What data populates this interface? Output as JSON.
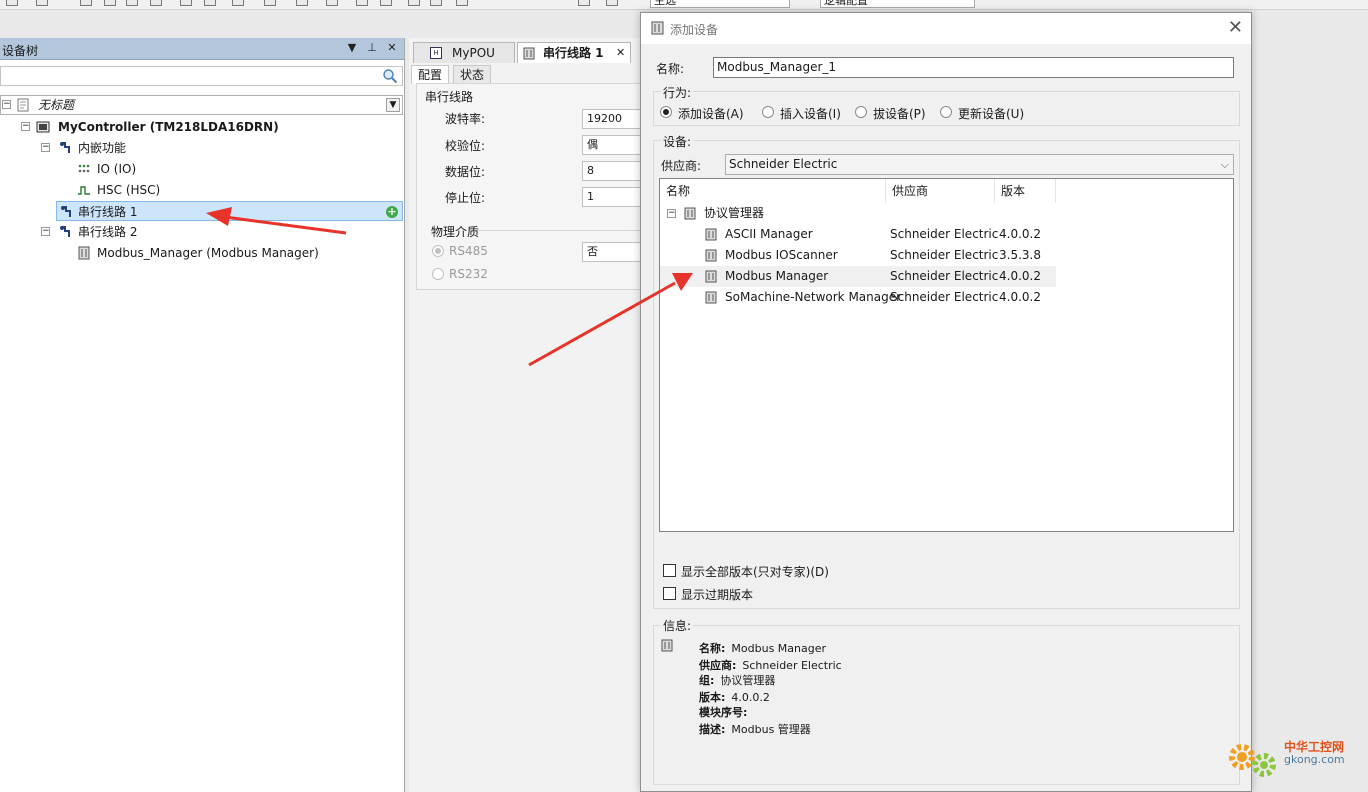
{
  "toolbar": {
    "combo1": "主选",
    "combo2": "逻辑配置"
  },
  "device_tree": {
    "title": "设备树",
    "pin_glyph": "▼  ᵖ",
    "close_glyph": "✕",
    "nodes": {
      "root": "无标题",
      "controller": "MyController (TM218LDA16DRN)",
      "embedded": "内嵌功能",
      "io": "IO (IO)",
      "hsc": "HSC (HSC)",
      "serial1": "串行线路 1",
      "serial2": "串行线路 2",
      "modbus": "Modbus_Manager (Modbus Manager)"
    }
  },
  "editor": {
    "tabs": {
      "mypou": "MyPOU",
      "serial": "串行线路 1"
    },
    "tab_close": "✕",
    "config_tabs": {
      "config": "配置",
      "status": "状态"
    },
    "group_serial": "串行线路",
    "fields": {
      "baud_label": "波特率:",
      "baud_value": "19200",
      "parity_label": "校验位:",
      "parity_value": "偶",
      "databits_label": "数据位:",
      "databits_value": "8",
      "stopbits_label": "停止位:",
      "stopbits_value": "1"
    },
    "group_medium": "物理介质",
    "medium": {
      "rs485": "RS485",
      "rs232": "RS232",
      "value": "否"
    }
  },
  "dialog": {
    "title": "添加设备",
    "close_glyph": "✕",
    "name_label": "名称:",
    "name_value": "Modbus_Manager_1",
    "action_label": "行为:",
    "actions": [
      {
        "label": "添加设备(A)",
        "selected": true
      },
      {
        "label": "插入设备(I)",
        "selected": false
      },
      {
        "label": "拔设备(P)",
        "selected": false
      },
      {
        "label": "更新设备(U)",
        "selected": false
      }
    ],
    "device_label": "设备:",
    "vendor_label": "供应商:",
    "vendor_value": "Schneider Electric",
    "columns": {
      "name": "名称",
      "vendor": "供应商",
      "version": "版本"
    },
    "category": "协议管理器",
    "devices": [
      {
        "name": "ASCII Manager",
        "vendor": "Schneider Electric",
        "version": "4.0.0.2"
      },
      {
        "name": "Modbus IOScanner",
        "vendor": "Schneider Electric",
        "version": "3.5.3.8"
      },
      {
        "name": "Modbus Manager",
        "vendor": "Schneider Electric",
        "version": "4.0.0.2"
      },
      {
        "name": "SoMachine-Network Manager",
        "vendor": "Schneider Electric",
        "version": "4.0.0.2"
      }
    ],
    "checkbox_all_versions": "显示全部版本(只对专家)(D)",
    "checkbox_outdated": "显示过期版本",
    "info_label": "信息:",
    "info": {
      "name_key": "名称:",
      "name_val": "Modbus Manager",
      "vendor_key": "供应商:",
      "vendor_val": "Schneider Electric",
      "group_key": "组:",
      "group_val": "协议管理器",
      "version_key": "版本:",
      "version_val": "4.0.0.2",
      "module_key": "模块序号:",
      "module_val": "",
      "desc_key": "描述:",
      "desc_val": "Modbus 管理器"
    }
  },
  "watermark": {
    "title": "中华工控网",
    "url": "gkong.com"
  },
  "colors": {
    "tree_header": "#b3c6db",
    "selection": "#cde5fb",
    "arrow": "#e8332a",
    "add_icon": "#3fa84a"
  }
}
